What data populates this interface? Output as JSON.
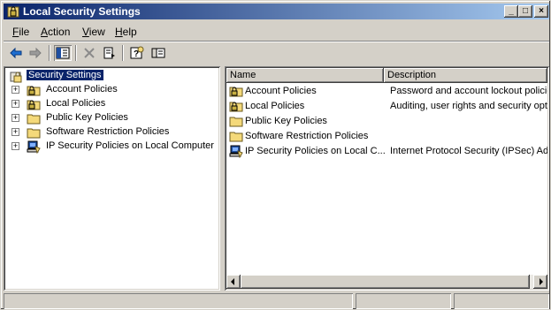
{
  "window": {
    "title": "Local Security Settings",
    "controls": {
      "minimize": "_",
      "maximize": "□",
      "close": "×"
    }
  },
  "menu": [
    {
      "label": "File",
      "mnemonic": "F",
      "rest": "ile"
    },
    {
      "label": "Action",
      "mnemonic": "A",
      "rest": "ction"
    },
    {
      "label": "View",
      "mnemonic": "V",
      "rest": "iew"
    },
    {
      "label": "Help",
      "mnemonic": "H",
      "rest": "elp"
    }
  ],
  "toolbar": {
    "buttons": [
      "back-icon",
      "forward-icon",
      "show-hide-tree-icon",
      "delete-icon",
      "export-list-icon",
      "help-icon",
      "properties-icon"
    ]
  },
  "tree": {
    "root": {
      "label": "Security Settings",
      "icon": "security-settings-icon"
    },
    "items": [
      {
        "label": "Account Policies",
        "icon": "folder-lock-icon",
        "expander": "+"
      },
      {
        "label": "Local Policies",
        "icon": "folder-lock-icon",
        "expander": "+"
      },
      {
        "label": "Public Key Policies",
        "icon": "folder-icon",
        "expander": "+"
      },
      {
        "label": "Software Restriction Policies",
        "icon": "folder-icon",
        "expander": "+"
      },
      {
        "label": "IP Security Policies on Local Computer",
        "icon": "ip-security-icon",
        "expander": "+"
      }
    ]
  },
  "list": {
    "columns": [
      "Name",
      "Description"
    ],
    "rows": [
      {
        "name": "Account Policies",
        "description": "Password and account lockout policies",
        "icon": "folder-lock-icon"
      },
      {
        "name": "Local Policies",
        "description": "Auditing, user rights and security options",
        "icon": "folder-lock-icon"
      },
      {
        "name": "Public Key Policies",
        "description": "",
        "icon": "folder-icon"
      },
      {
        "name": "Software Restriction Policies",
        "description": "",
        "icon": "folder-icon"
      },
      {
        "name": "IP Security Policies on Local C...",
        "description": "Internet Protocol Security (IPSec) Administration",
        "icon": "ip-security-icon"
      }
    ]
  },
  "colors": {
    "titlebar_start": "#0a246a",
    "titlebar_end": "#a6caf0",
    "chrome": "#d4d0c8",
    "selection": "#0a246a",
    "folder": "#f4d97a"
  }
}
